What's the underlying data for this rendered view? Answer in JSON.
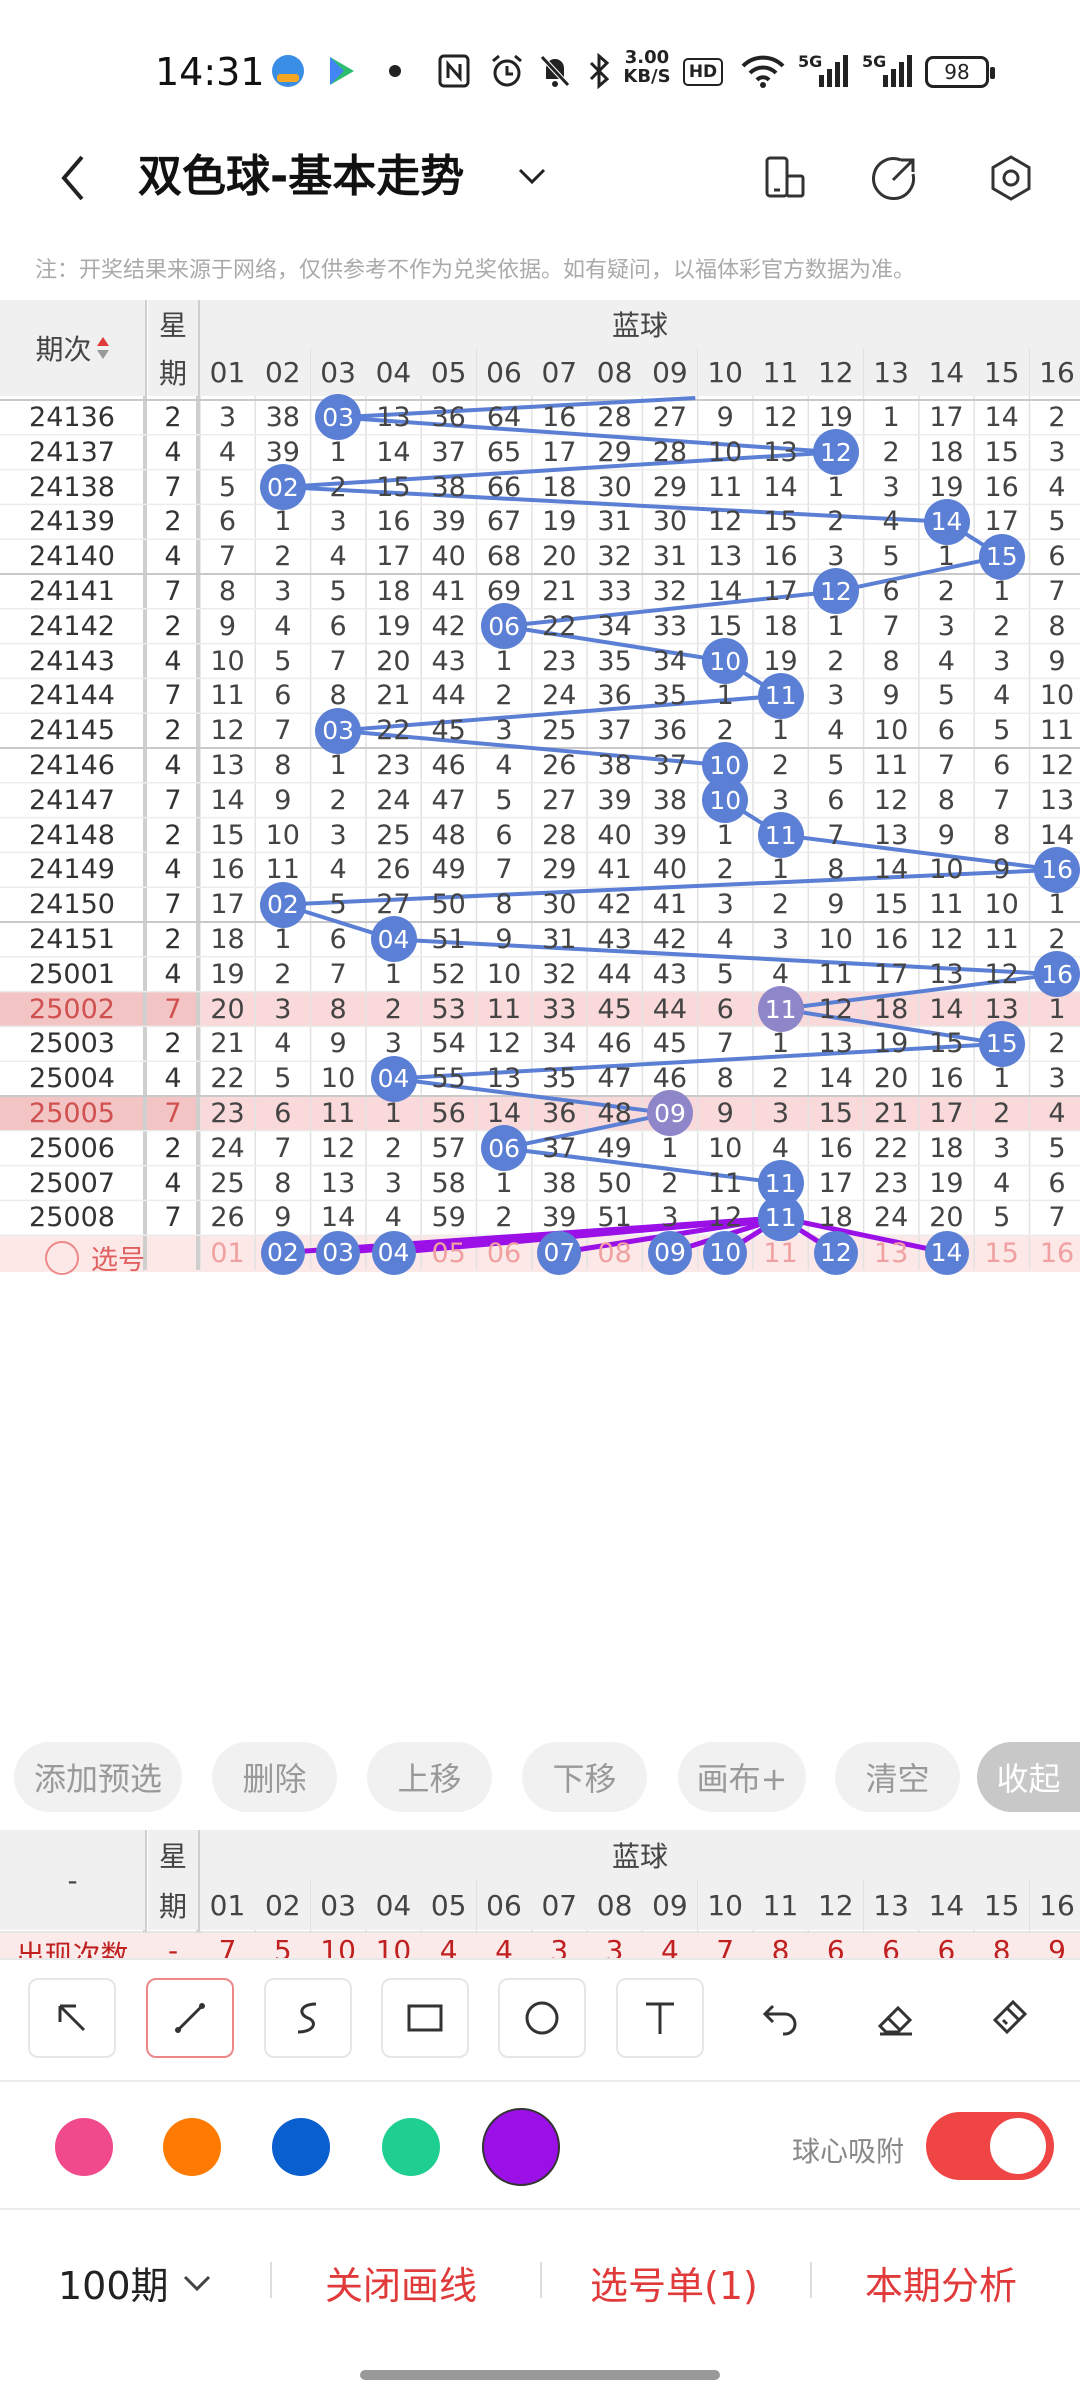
{
  "status_bar": {
    "time": "14:31",
    "network_speed": "3.00\nKB/S",
    "hd_badge": "HD",
    "signal_1": "5G",
    "signal_2": "5G",
    "battery": "98"
  },
  "header": {
    "title": "双色球-基本走势"
  },
  "notice": "注：开奖结果来源于网络，仅供参考不作为兑奖依据。如有疑问，以福体彩官方数据为准。",
  "table": {
    "col_issue": "期次",
    "col_week_1": "星",
    "col_week_2": "期",
    "section_title": "蓝球",
    "numbers": [
      "01",
      "02",
      "03",
      "04",
      "05",
      "06",
      "07",
      "08",
      "09",
      "10",
      "11",
      "12",
      "13",
      "14",
      "15",
      "16"
    ],
    "rows": [
      {
        "issue": "24136",
        "week": "2",
        "cells": [
          "3",
          "38",
          "03",
          "13",
          "36",
          "64",
          "16",
          "28",
          "27",
          "9",
          "12",
          "19",
          "1",
          "17",
          "14",
          "2"
        ],
        "hit": 3
      },
      {
        "issue": "24137",
        "week": "4",
        "cells": [
          "4",
          "39",
          "1",
          "14",
          "37",
          "65",
          "17",
          "29",
          "28",
          "10",
          "13",
          "12",
          "2",
          "18",
          "15",
          "3"
        ],
        "hit": 12
      },
      {
        "issue": "24138",
        "week": "7",
        "cells": [
          "5",
          "02",
          "2",
          "15",
          "38",
          "66",
          "18",
          "30",
          "29",
          "11",
          "14",
          "1",
          "3",
          "19",
          "16",
          "4"
        ],
        "hit": 2
      },
      {
        "issue": "24139",
        "week": "2",
        "cells": [
          "6",
          "1",
          "3",
          "16",
          "39",
          "67",
          "19",
          "31",
          "30",
          "12",
          "15",
          "2",
          "4",
          "14",
          "17",
          "5"
        ],
        "hit": 14
      },
      {
        "issue": "24140",
        "week": "4",
        "cells": [
          "7",
          "2",
          "4",
          "17",
          "40",
          "68",
          "20",
          "32",
          "31",
          "13",
          "16",
          "3",
          "5",
          "1",
          "15",
          "6"
        ],
        "hit": 15
      },
      {
        "issue": "24141",
        "week": "7",
        "cells": [
          "8",
          "3",
          "5",
          "18",
          "41",
          "69",
          "21",
          "33",
          "32",
          "14",
          "17",
          "12",
          "6",
          "2",
          "1",
          "7"
        ],
        "hit": 12
      },
      {
        "issue": "24142",
        "week": "2",
        "cells": [
          "9",
          "4",
          "6",
          "19",
          "42",
          "06",
          "22",
          "34",
          "33",
          "15",
          "18",
          "1",
          "7",
          "3",
          "2",
          "8"
        ],
        "hit": 6
      },
      {
        "issue": "24143",
        "week": "4",
        "cells": [
          "10",
          "5",
          "7",
          "20",
          "43",
          "1",
          "23",
          "35",
          "34",
          "10",
          "19",
          "2",
          "8",
          "4",
          "3",
          "9"
        ],
        "hit": 10
      },
      {
        "issue": "24144",
        "week": "7",
        "cells": [
          "11",
          "6",
          "8",
          "21",
          "44",
          "2",
          "24",
          "36",
          "35",
          "1",
          "11",
          "3",
          "9",
          "5",
          "4",
          "10"
        ],
        "hit": 11
      },
      {
        "issue": "24145",
        "week": "2",
        "cells": [
          "12",
          "7",
          "03",
          "22",
          "45",
          "3",
          "25",
          "37",
          "36",
          "2",
          "1",
          "4",
          "10",
          "6",
          "5",
          "11"
        ],
        "hit": 3
      },
      {
        "issue": "24146",
        "week": "4",
        "cells": [
          "13",
          "8",
          "1",
          "23",
          "46",
          "4",
          "26",
          "38",
          "37",
          "10",
          "2",
          "5",
          "11",
          "7",
          "6",
          "12"
        ],
        "hit": 10
      },
      {
        "issue": "24147",
        "week": "7",
        "cells": [
          "14",
          "9",
          "2",
          "24",
          "47",
          "5",
          "27",
          "39",
          "38",
          "10",
          "3",
          "6",
          "12",
          "8",
          "7",
          "13"
        ],
        "hit": 10
      },
      {
        "issue": "24148",
        "week": "2",
        "cells": [
          "15",
          "10",
          "3",
          "25",
          "48",
          "6",
          "28",
          "40",
          "39",
          "1",
          "11",
          "7",
          "13",
          "9",
          "8",
          "14"
        ],
        "hit": 11
      },
      {
        "issue": "24149",
        "week": "4",
        "cells": [
          "16",
          "11",
          "4",
          "26",
          "49",
          "7",
          "29",
          "41",
          "40",
          "2",
          "1",
          "8",
          "14",
          "10",
          "9",
          "16"
        ],
        "hit": 16
      },
      {
        "issue": "24150",
        "week": "7",
        "cells": [
          "17",
          "02",
          "5",
          "27",
          "50",
          "8",
          "30",
          "42",
          "41",
          "3",
          "2",
          "9",
          "15",
          "11",
          "10",
          "1"
        ],
        "hit": 2
      },
      {
        "issue": "24151",
        "week": "2",
        "cells": [
          "18",
          "1",
          "6",
          "04",
          "51",
          "9",
          "31",
          "43",
          "42",
          "4",
          "3",
          "10",
          "16",
          "12",
          "11",
          "2"
        ],
        "hit": 4
      },
      {
        "issue": "25001",
        "week": "4",
        "cells": [
          "19",
          "2",
          "7",
          "1",
          "52",
          "10",
          "32",
          "44",
          "43",
          "5",
          "4",
          "11",
          "17",
          "13",
          "12",
          "16"
        ],
        "hit": 16
      },
      {
        "issue": "25002",
        "week": "7",
        "cells": [
          "20",
          "3",
          "8",
          "2",
          "53",
          "11",
          "33",
          "45",
          "44",
          "6",
          "11",
          "12",
          "18",
          "14",
          "13",
          "1"
        ],
        "hit": 11,
        "highlight": true
      },
      {
        "issue": "25003",
        "week": "2",
        "cells": [
          "21",
          "4",
          "9",
          "3",
          "54",
          "12",
          "34",
          "46",
          "45",
          "7",
          "1",
          "13",
          "19",
          "15",
          "15",
          "2"
        ],
        "hit": 15
      },
      {
        "issue": "25004",
        "week": "4",
        "cells": [
          "22",
          "5",
          "10",
          "04",
          "55",
          "13",
          "35",
          "47",
          "46",
          "8",
          "2",
          "14",
          "20",
          "16",
          "1",
          "3"
        ],
        "hit": 4
      },
      {
        "issue": "25005",
        "week": "7",
        "cells": [
          "23",
          "6",
          "11",
          "1",
          "56",
          "14",
          "36",
          "48",
          "09",
          "9",
          "3",
          "15",
          "21",
          "17",
          "2",
          "4"
        ],
        "hit": 9,
        "highlight": true
      },
      {
        "issue": "25006",
        "week": "2",
        "cells": [
          "24",
          "7",
          "12",
          "2",
          "57",
          "06",
          "37",
          "49",
          "1",
          "10",
          "4",
          "16",
          "22",
          "18",
          "3",
          "5"
        ],
        "hit": 6
      },
      {
        "issue": "25007",
        "week": "4",
        "cells": [
          "25",
          "8",
          "13",
          "3",
          "58",
          "1",
          "38",
          "50",
          "2",
          "11",
          "11",
          "17",
          "23",
          "19",
          "4",
          "6"
        ],
        "hit": 11
      },
      {
        "issue": "25008",
        "week": "7",
        "cells": [
          "26",
          "9",
          "14",
          "4",
          "59",
          "2",
          "39",
          "51",
          "3",
          "12",
          "11",
          "18",
          "24",
          "20",
          "5",
          "7"
        ],
        "hit": 11
      }
    ],
    "pick_row": {
      "label": "选号",
      "selected": [
        2,
        3,
        4,
        7,
        9,
        10,
        12,
        14
      ],
      "numbers": [
        "01",
        "02",
        "03",
        "04",
        "05",
        "06",
        "07",
        "08",
        "09",
        "10",
        "11",
        "12",
        "13",
        "14",
        "15",
        "16"
      ]
    }
  },
  "actions": {
    "add_preselect": "添加预选",
    "delete": "删除",
    "move_up": "上移",
    "move_down": "下移",
    "canvas_plus": "画布+",
    "clear": "清空",
    "collapse": "收起"
  },
  "stats": {
    "col_issue": "-",
    "col_week_1": "星",
    "col_week_2": "期",
    "section_title": "蓝球",
    "row_label": "出现次数",
    "row_week": "-",
    "counts": [
      "7",
      "5",
      "10",
      "10",
      "4",
      "4",
      "3",
      "3",
      "4",
      "7",
      "8",
      "6",
      "6",
      "6",
      "8",
      "9"
    ]
  },
  "drawing": {
    "tools": [
      "arrow-icon",
      "line-icon",
      "freehand-icon",
      "rectangle-icon",
      "circle-icon",
      "text-icon",
      "undo-icon",
      "eraser-icon",
      "brush-clear-icon"
    ],
    "colors": [
      "#f04a8c",
      "#ff7a00",
      "#0a5fcf",
      "#1ecf8f",
      "#9a10e6"
    ],
    "selected_color": "#9a10e6",
    "snap_label": "球心吸附",
    "snap_on": true
  },
  "bottom_bar": {
    "period": "100期",
    "close_lines": "关闭画线",
    "pick_list": "选号单(1)",
    "analysis": "本期分析"
  }
}
